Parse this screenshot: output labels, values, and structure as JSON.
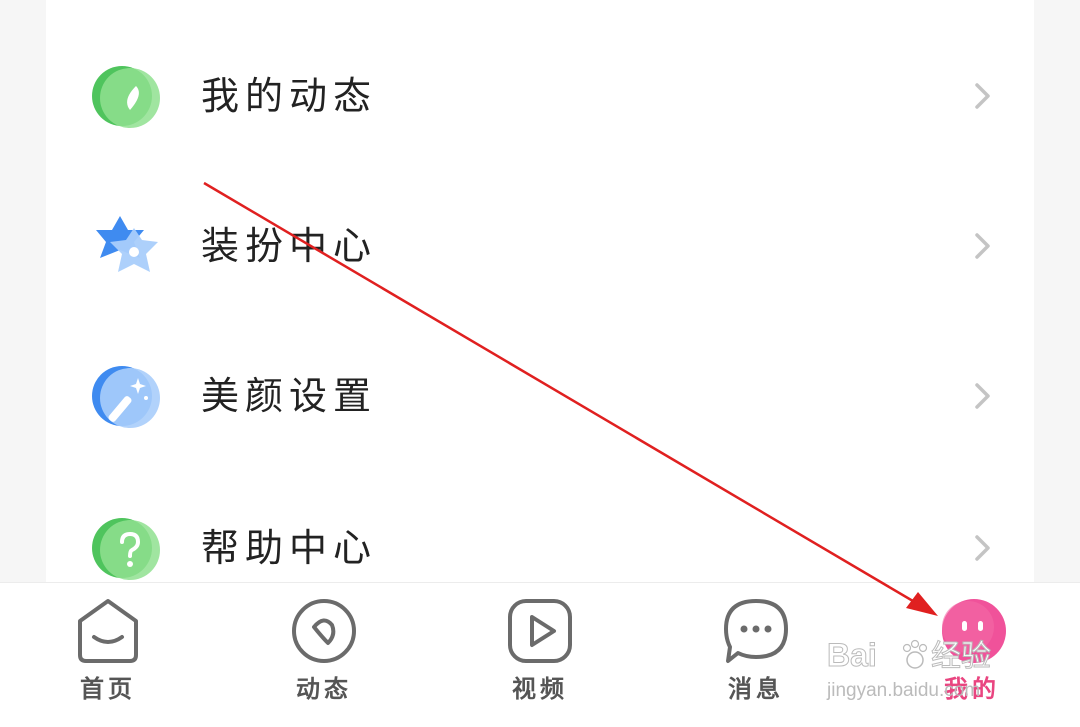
{
  "menu": {
    "items": [
      {
        "label": "我的动态",
        "icon": "compass-icon"
      },
      {
        "label": "装扮中心",
        "icon": "star-icon"
      },
      {
        "label": "美颜设置",
        "icon": "magic-wand-icon"
      },
      {
        "label": "帮助中心",
        "icon": "help-icon"
      }
    ]
  },
  "tabbar": {
    "tabs": [
      {
        "label": "首页",
        "icon": "home-icon",
        "active": false
      },
      {
        "label": "动态",
        "icon": "moments-icon",
        "active": false
      },
      {
        "label": "视频",
        "icon": "video-icon",
        "active": false
      },
      {
        "label": "消息",
        "icon": "message-icon",
        "active": false
      },
      {
        "label": "我的",
        "icon": "profile-icon",
        "active": true
      }
    ]
  },
  "watermark": {
    "brand": "Bai",
    "brand_suffix": "经验",
    "url": "jingyan.baidu.com"
  },
  "colors": {
    "accent": "#e94580",
    "green": "#5fcb6a",
    "blue": "#5b9cf2",
    "chevron": "#c4c4c4",
    "tab_icon": "#6b6b6b",
    "arrow": "#e02020"
  }
}
